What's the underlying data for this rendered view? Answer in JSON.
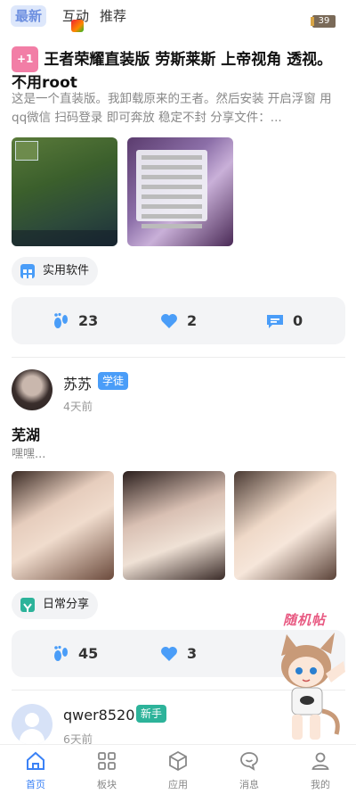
{
  "top_tabs": [
    {
      "label": "最新"
    },
    {
      "label": "互动"
    },
    {
      "label": "推荐"
    }
  ],
  "level_badge": "39",
  "posts": [
    {
      "tag": "+1",
      "title": "王者荣耀直装版 劳斯莱斯 上帝视角 透视。不用root",
      "description": "这是一个直装版。我卸载原来的王者。然后安装 开启浮窗 用qq微信 扫码登录 即可奔放 稳定不封 分享文件：...",
      "category": "实用软件",
      "stats": {
        "footprints": "23",
        "likes": "2",
        "comments": "0"
      }
    },
    {
      "username": "苏苏",
      "role": "学徒",
      "time": "4天前",
      "title": "芜湖",
      "description": "嘿嘿...",
      "category": "日常分享",
      "stats": {
        "footprints": "45",
        "likes": "3"
      }
    },
    {
      "username": "qwer8520",
      "role": "新手",
      "time": "6天前"
    }
  ],
  "floating": {
    "label": "随机帖"
  },
  "bottom_nav": [
    {
      "label": "首页"
    },
    {
      "label": "板块"
    },
    {
      "label": "应用"
    },
    {
      "label": "消息"
    },
    {
      "label": "我的"
    }
  ],
  "colors": {
    "accent": "#3b82f6",
    "tag_pink": "#f27ea6",
    "role_blue": "#4a9df8",
    "role_teal": "#2db39a",
    "stat_icon": "#4a9df8"
  }
}
